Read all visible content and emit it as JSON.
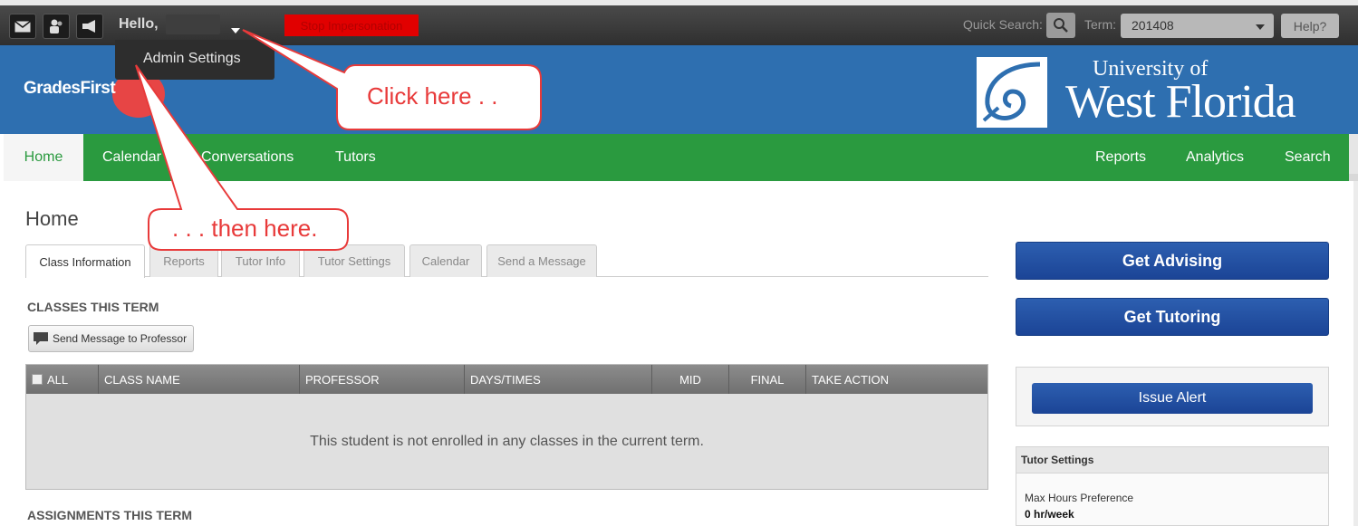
{
  "topbar": {
    "hello": "Hello,",
    "stop_label": "Stop Impersonation",
    "quick_search_label": "Quick Search:",
    "term_label": "Term:",
    "term_value": "201408",
    "help_label": "Help?",
    "admin_menu_item": "Admin Settings"
  },
  "header": {
    "brand": "GradesFirst",
    "uni_top": "University of",
    "uni_name": "West Florida"
  },
  "nav": {
    "left": [
      "Home",
      "Calendar",
      "Conversations",
      "Tutors"
    ],
    "right": [
      "Reports",
      "Analytics",
      "Search"
    ]
  },
  "main": {
    "title": "Home",
    "tabs": [
      "Class Information",
      "Reports",
      "Tutor Info",
      "Tutor Settings",
      "Calendar",
      "Send a Message"
    ],
    "classes_title": "CLASSES THIS TERM",
    "send_prof_label": "Send Message to Professor",
    "columns": [
      "ALL",
      "CLASS NAME",
      "PROFESSOR",
      "DAYS/TIMES",
      "MID",
      "FINAL",
      "TAKE ACTION"
    ],
    "empty_message": "This student is not enrolled in any classes in the current term.",
    "assignments_title": "ASSIGNMENTS THIS TERM"
  },
  "side": {
    "advising": "Get Advising",
    "tutoring": "Get Tutoring",
    "issue_alert": "Issue Alert",
    "tutor_settings_title": "Tutor Settings",
    "max_hours_label": "Max Hours Preference",
    "max_hours_value": "0 hr/week"
  },
  "callouts": {
    "first": "Click here . .",
    "second": ". . . then here."
  },
  "colors": {
    "nav_green": "#2a9a3f",
    "header_blue": "#2e6fb0",
    "button_blue": "#1b4496",
    "callout_red": "#e83a3a"
  }
}
